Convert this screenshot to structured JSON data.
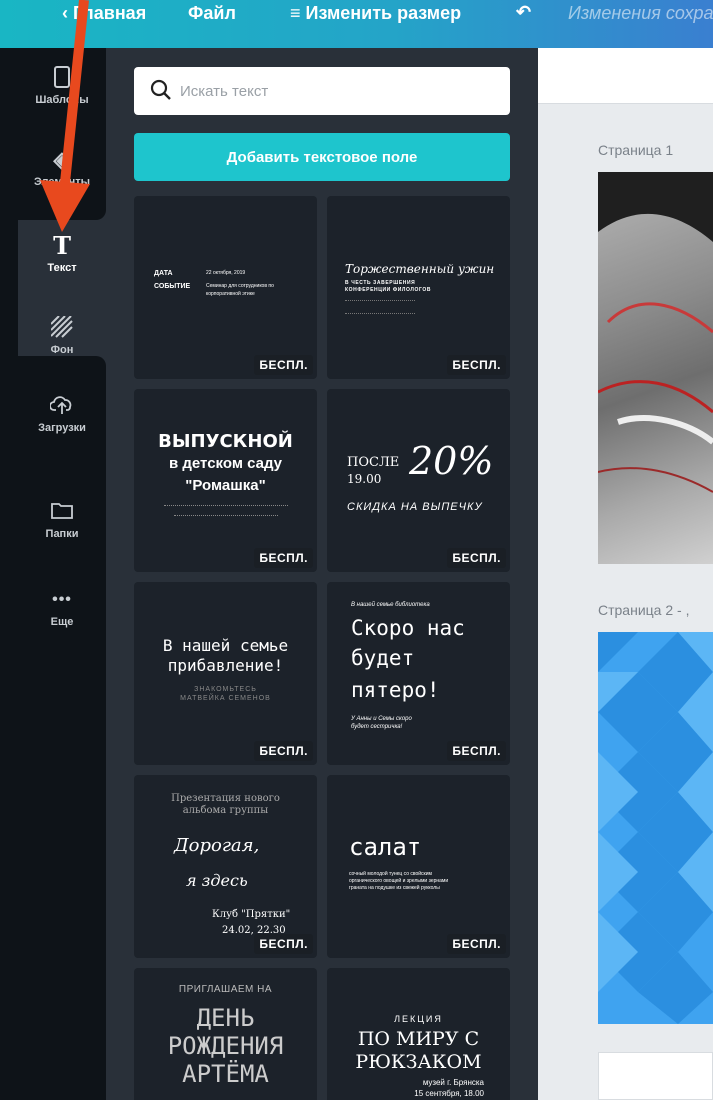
{
  "topbar": {
    "back_label": "‹ Главная",
    "file_label": "Файл",
    "resize_label": "≡ Изменить размер",
    "undo_icon": "undo-icon",
    "saved_label": "Изменения сохра"
  },
  "sidebar": {
    "items": [
      {
        "label": "Шаблоны",
        "icon": "template-icon"
      },
      {
        "label": "Элементы",
        "icon": "shapes-icon"
      },
      {
        "label": "Текст",
        "icon": "text-icon"
      },
      {
        "label": "Фон",
        "icon": "background-hatch-icon"
      },
      {
        "label": "Загрузки",
        "icon": "cloud-upload-icon"
      },
      {
        "label": "Папки",
        "icon": "folder-icon"
      },
      {
        "label": "Еще",
        "icon": "more-dots-icon"
      }
    ]
  },
  "panel": {
    "search_placeholder": "Искать текст",
    "add_button": "Добавить текстовое поле",
    "badge": "БЕСПЛ.",
    "tiles": {
      "t1": {
        "l1a": "ДАТА",
        "l1b": "22 октября, 2019",
        "l2a": "СОБЫТИЕ",
        "l2b": "Семинар для сотрудников по",
        "l2c": "корпоративной этике"
      },
      "t2": {
        "title": "Торжественный ужин",
        "sub1": "В ЧЕСТЬ ЗАВЕРШЕНИЯ",
        "sub2": "КОНФЕРЕНЦИИ ФИЛОЛОГОВ"
      },
      "t3": {
        "l1": "ВЫПУСКНОЙ",
        "l2": "в детском саду",
        "l3": "\"Ромашка\""
      },
      "t4": {
        "after": "ПОСЛЕ",
        "time": "19.00",
        "pct": "20%",
        "sub": "СКИДКА НА ВЫПЕЧКУ"
      },
      "t5": {
        "l1": "В нашей семье",
        "l2": "прибавление!",
        "s1": "ЗНАКОМЬТЕСЬ",
        "s2": "МАТВЕЙКА СЕМЕНОВ"
      },
      "t6": {
        "top": "В нашей семье библиотека",
        "l1": "Скоро нас",
        "l2": "будет",
        "l3": "пятеро!",
        "s1": "У Анны и Семы скоро",
        "s2": "будет сестричка!"
      },
      "t7": {
        "p1": "Презентация нового",
        "p2": "альбома группы",
        "l1": "Дорогая,",
        "l2": "я здесь",
        "club": "Клуб \"Прятки\"",
        "date": "24.02, 22.30"
      },
      "t8": {
        "title": "салат",
        "d1": "сочный молодой тунец со свойским",
        "d2": "органического овощей и зрелыми зернами",
        "d3": "граната на подушке из свежей рукколы"
      },
      "t9": {
        "l0": "ПРИГЛАШАЕМ НА",
        "l1": "ДЕНЬ",
        "l2": "РОЖДЕНИЯ",
        "l3": "АРТЁМА"
      },
      "t10": {
        "l0": "ЛЕКЦИЯ",
        "l1": "ПО МИРУ С",
        "l2": "РЮКЗАКОМ",
        "s1": "музей г. Брянска",
        "s2": "15 сентября, 18.00"
      }
    }
  },
  "canvas": {
    "page1_label": "Страница 1",
    "page2_label": "Страница 2 - ,"
  },
  "colors": {
    "accent": "#1ec5cd",
    "annotation_arrow": "#e8491e",
    "panel_bg": "#293039",
    "rail_bg": "#0e1318"
  }
}
